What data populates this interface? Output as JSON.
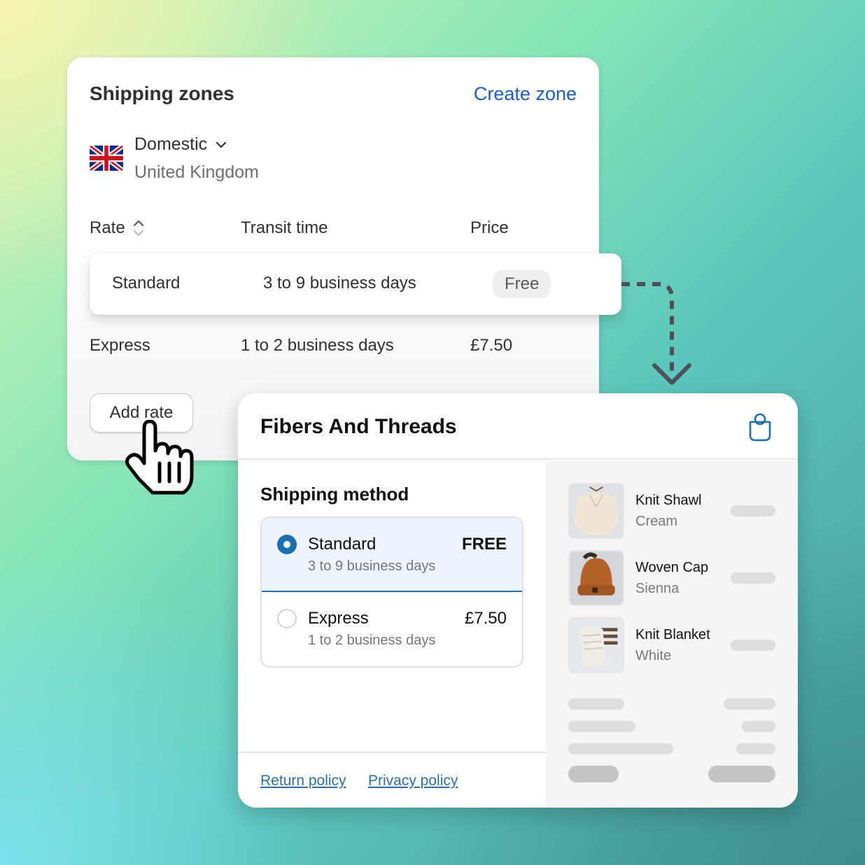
{
  "colors": {
    "link_blue": "#1a5fd0",
    "accent_blue": "#1d6fb3",
    "selected_bg": "#eef4fd",
    "text_dark": "#303030",
    "arrow": "#4f4f58"
  },
  "zones": {
    "title": "Shipping zones",
    "create_label": "Create zone",
    "zone": {
      "name": "Domestic",
      "country": "United Kingdom",
      "flag_icon": "uk-flag-icon",
      "chevron_icon": "chevron-down-icon"
    },
    "columns": {
      "rate": "Rate",
      "transit": "Transit time",
      "price": "Price",
      "sort_icon": "sort-icon"
    },
    "rates": [
      {
        "name": "Standard",
        "transit": "3 to 9 business days",
        "price": "Free",
        "highlighted": true
      },
      {
        "name": "Express",
        "transit": "1 to 2 business days",
        "price": "£7.50",
        "highlighted": false
      }
    ],
    "add_rate_label": "Add rate"
  },
  "checkout": {
    "store_name": "Fibers And Threads",
    "bag_icon": "shopping-bag-icon",
    "shipping_method_title": "Shipping method",
    "options": [
      {
        "name": "Standard",
        "days": "3 to 9 business days",
        "price": "FREE",
        "selected": true
      },
      {
        "name": "Express",
        "days": "1 to 2 business days",
        "price": "£7.50",
        "selected": false
      }
    ],
    "links": {
      "return": "Return policy",
      "privacy": "Privacy policy"
    },
    "items": [
      {
        "name": "Knit Shawl",
        "variant": "Cream"
      },
      {
        "name": "Woven Cap",
        "variant": "Sienna"
      },
      {
        "name": "Knit Blanket",
        "variant": "White"
      }
    ]
  }
}
